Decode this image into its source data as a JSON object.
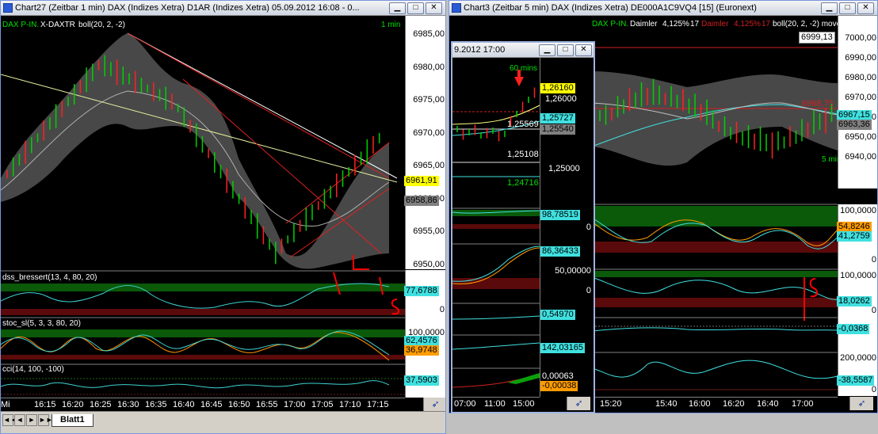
{
  "colors": {
    "up": "#00d000",
    "down": "#ff2020",
    "band": "#5a5a5a",
    "axis_bg": "#ffffff",
    "accent_blue": "#2a5bd7"
  },
  "chart27": {
    "title": "Chart27 (Zeitbar 1 min)   DAX (Indizes Xetra) D1AR (Indizes Xetra) 05.09.2012 16:08 - 0...",
    "legend": {
      "a": "DAX P-IN.",
      "b": "X-DAXTR",
      "c": "boll(20, 2, -2)"
    },
    "interval": "1 min",
    "price_ticks": [
      "6985,00",
      "6980,00",
      "6975,00",
      "6970,00",
      "6965,00",
      "6960,00",
      "6955,00",
      "6950,00"
    ],
    "last_price": "6961,91",
    "band_value": "6958,86",
    "dss": {
      "label": "dss_bressert(13, 4, 80, 20)",
      "value": "77,6788",
      "zero": "0"
    },
    "stoc": {
      "label": "stoc_sl(5, 3, 3, 80, 20)",
      "top": "100,0000",
      "v1": "62,4576",
      "v2": "36,9748",
      "zero": "0"
    },
    "cci": {
      "label": "cci(14, 100, -100)",
      "value": "37,5903"
    },
    "time_labels": [
      "Mi",
      "16:15",
      "16:20",
      "16:25",
      "16:30",
      "16:35",
      "16:40",
      "16:45",
      "16:50",
      "16:55",
      "17:00",
      "17:05",
      "17:10",
      "17:15"
    ],
    "sheet_tab": "Blatt1",
    "nav": [
      "◄◄",
      "◄",
      "►",
      "►►"
    ]
  },
  "chart3": {
    "title": "Chart3 (Zeitbar 5 min)   DAX (Indizes Xetra) DE000A1C9VQ4 [15] (Euronext)",
    "legend": {
      "a": "DAX P-IN.",
      "b": "Daimler",
      "c": "4,125%",
      "d": "17",
      "e": "Daimler",
      "f": "4,125%",
      "g": "17",
      "h": "boll(20, 2, -2) move(9, 0) movs(60, 0)"
    },
    "interval": "5 mins",
    "price_ticks": [
      "7000,00",
      "6990,00",
      "6980,00",
      "6970,00",
      "6960,00",
      "6950,00",
      "6940,00"
    ],
    "tag_top": "6999,13",
    "tag_red": "6968,75",
    "tag_cyan": "6967,15",
    "tag_gray": "6963,36",
    "osc1": {
      "top": "100,0000",
      "v1": "54,8246",
      "v2": "41,2759",
      "zero": "0"
    },
    "osc2": {
      "top": "100,0000",
      "value": "18,0262",
      "zero": "0"
    },
    "osc3": {
      "value": "-0,0368"
    },
    "osc4": {
      "top": "200,0000",
      "value": "-38,5587",
      "zero": "0"
    },
    "time_labels": [
      "15:20",
      "15:40",
      "16:00",
      "16:20",
      "16:40",
      "17:00"
    ]
  },
  "floating": {
    "title": "9.2012 17:00",
    "interval": "60 mins",
    "tags": {
      "t1": "1,26160",
      "t2": "1,26000",
      "t3": "1,25727",
      "t4": "1,25569",
      "t5": "1,25540",
      "t6": "1,25108",
      "t7": "1,25000",
      "t8": "1,24716"
    },
    "osc1": {
      "value": "98,78519",
      "zero": "0"
    },
    "osc2": {
      "value": "86,36433",
      "mid": "50,00000",
      "zero": "0"
    },
    "osc3": {
      "value": "0,54970"
    },
    "osc4": {
      "value": "142,03165"
    },
    "osc5": {
      "top": "0,00063",
      "value": "-0,00038"
    },
    "time_labels": [
      "07:00",
      "11:00",
      "15:00"
    ]
  }
}
